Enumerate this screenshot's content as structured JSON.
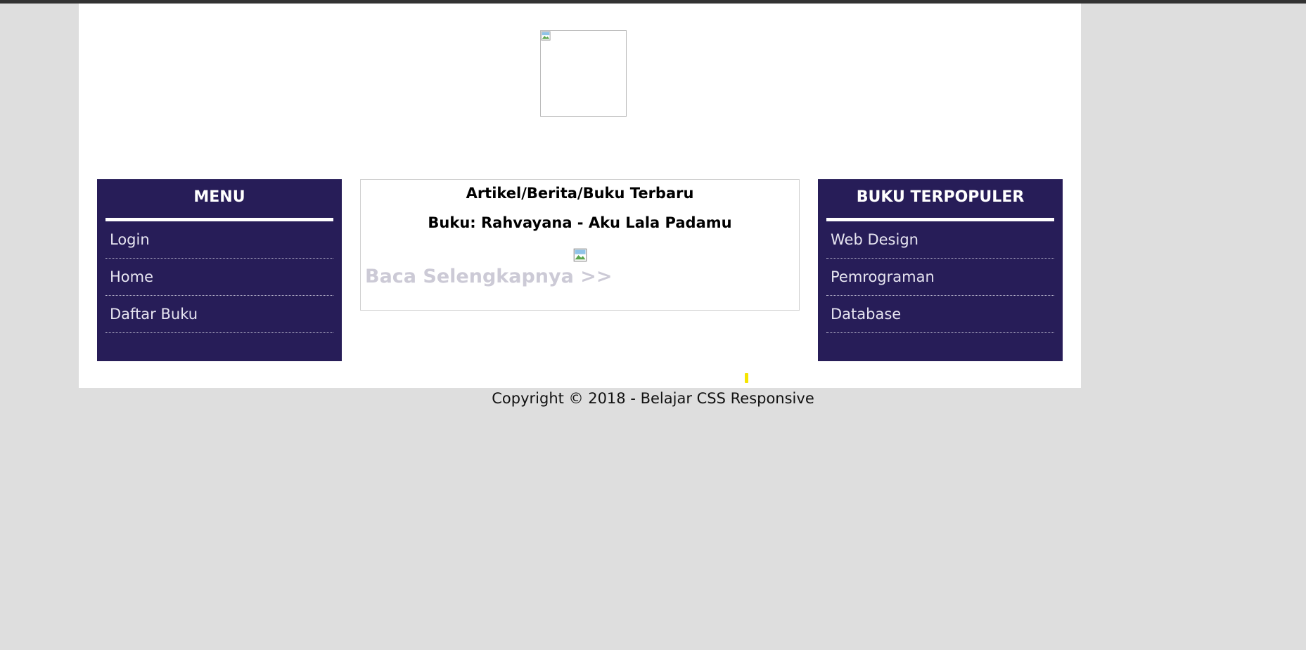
{
  "header": {
    "logo_alt": "",
    "logo_icon": "broken-image-icon"
  },
  "menu": {
    "title": "MENU",
    "items": [
      {
        "label": "Login"
      },
      {
        "label": "Home"
      },
      {
        "label": "Daftar Buku"
      }
    ]
  },
  "main": {
    "section_title": "Artikel/Berita/Buku Terbaru",
    "article_title": "Buku: Rahvayana - Aku Lala Padamu",
    "article_image_icon": "broken-image-icon",
    "read_more": "Baca Selengkapnya >>"
  },
  "popular": {
    "title": "BUKU TERPOPULER",
    "items": [
      {
        "label": "Web Design"
      },
      {
        "label": "Pemrograman"
      },
      {
        "label": "Database"
      }
    ]
  },
  "footer": {
    "copyright": "Copyright © 2018 - Belajar CSS Responsive"
  },
  "colors": {
    "page_background": "#dedede",
    "sidebar_background": "#271d58",
    "read_more_text": "#cccad6",
    "top_bar": "#333333"
  }
}
